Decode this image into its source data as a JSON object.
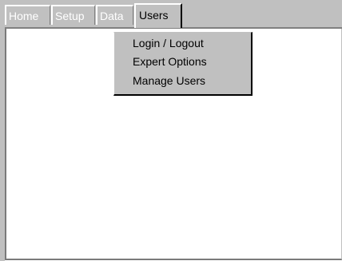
{
  "tabs": [
    {
      "label": "Home"
    },
    {
      "label": "Setup"
    },
    {
      "label": "Data"
    },
    {
      "label": "Users"
    }
  ],
  "active_tab": "Users",
  "users_menu": {
    "items": [
      {
        "label": "Login / Logout"
      },
      {
        "label": "Expert Options"
      },
      {
        "label": "Manage Users"
      }
    ]
  },
  "colors": {
    "chrome": "#c0c0c0",
    "content_background": "#ffffff",
    "inactive_tab_text": "#ffffff",
    "active_tab_text": "#000000",
    "menu_text": "#000000"
  }
}
